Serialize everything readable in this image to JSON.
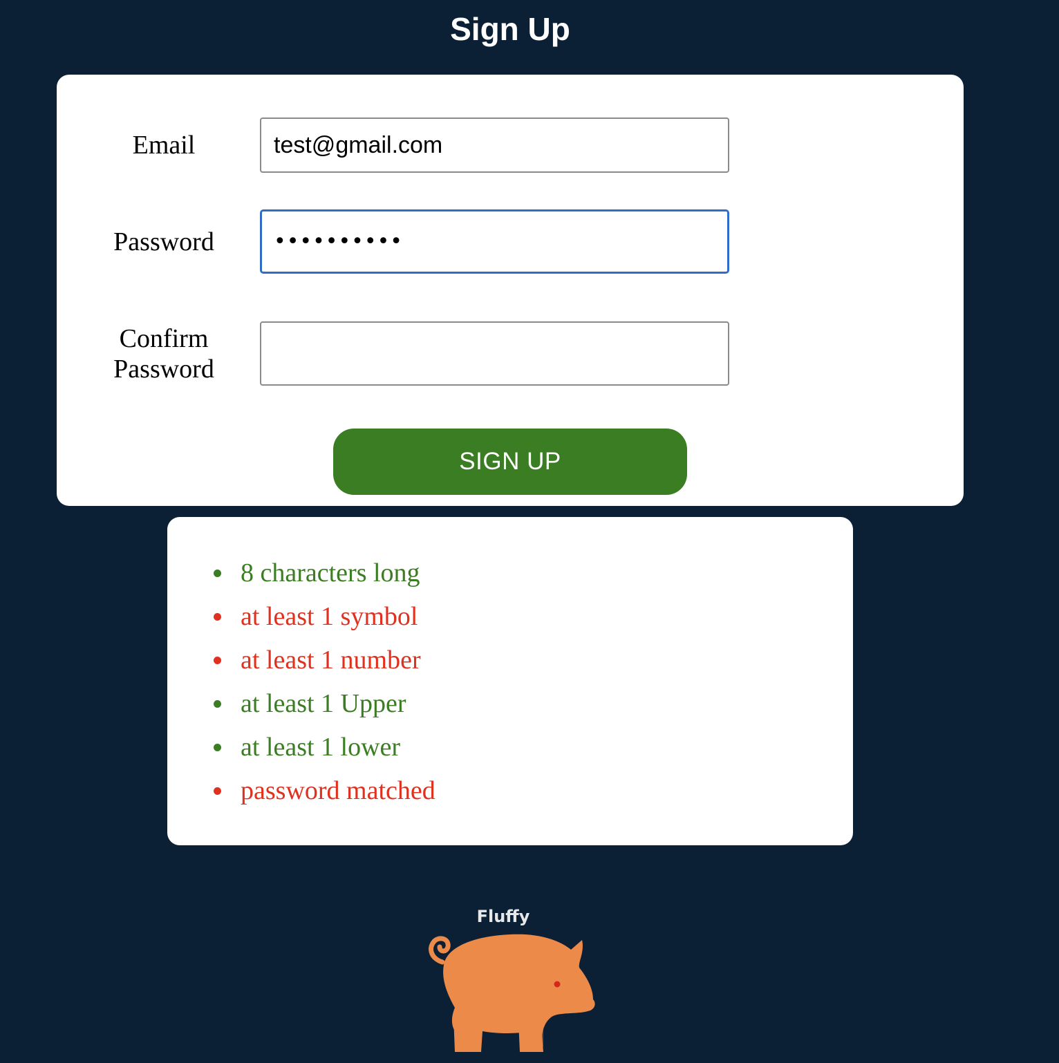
{
  "page": {
    "title": "Sign Up"
  },
  "form": {
    "email": {
      "label": "Email",
      "value": "test@gmail.com"
    },
    "password": {
      "label": "Password",
      "masked_value": "••••••••••"
    },
    "confirm_password": {
      "label_line1": "Confirm",
      "label_line2": "Password",
      "value": ""
    },
    "submit_label": "SIGN UP"
  },
  "password_rules": [
    {
      "text": "8 characters long",
      "status": "met",
      "color": "#3a7d22"
    },
    {
      "text": "at least 1 symbol",
      "status": "unmet",
      "color": "#e0301e"
    },
    {
      "text": "at least 1 number",
      "status": "unmet",
      "color": "#e0301e"
    },
    {
      "text": "at least 1 Upper",
      "status": "met",
      "color": "#3a7d22"
    },
    {
      "text": "at least 1 lower",
      "status": "met",
      "color": "#3a7d22"
    },
    {
      "text": "password matched",
      "status": "unmet",
      "color": "#e0301e"
    }
  ],
  "mascot": {
    "name": "Fluffy",
    "icon": "pig-icon"
  },
  "colors": {
    "background": "#0b1f35",
    "accent_green": "#3a7d22",
    "error_red": "#e0301e",
    "focus_blue": "#2f6cc8",
    "pig_orange": "#ec8a4a"
  }
}
